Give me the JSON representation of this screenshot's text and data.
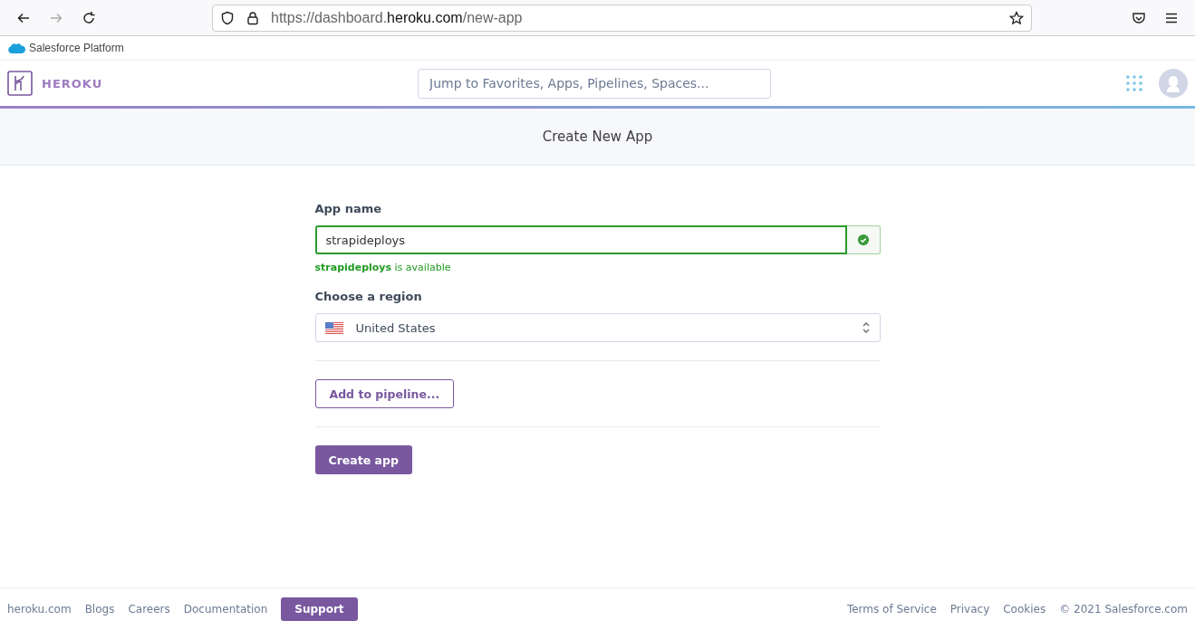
{
  "browser": {
    "url": "https://dashboard.**heroku.com**/new-app"
  },
  "bookmarks": [
    {
      "label": "Salesforce Platform"
    }
  ],
  "nav": {
    "brand": "HEROKU",
    "search": {
      "placeholder": "Jump to Favorites, Apps, Pipelines, Spaces..."
    }
  },
  "page_title": "Create New App",
  "form": {
    "app_name_label": "App name",
    "app_name_value": "strapideploys",
    "valid": true,
    "availability": "**strapideploys** is available",
    "region_label": "Choose a region",
    "region_value": "United States",
    "pipeline_button": "Add to pipeline...",
    "create_button": "Create app"
  },
  "footer": {
    "links_left": [
      "heroku.com",
      "Blogs",
      "Careers",
      "Documentation"
    ],
    "support": "Support",
    "links_right": [
      "Terms of Service",
      "Privacy",
      "Cookies"
    ],
    "copyright": "© 2021 Salesforce.com"
  }
}
